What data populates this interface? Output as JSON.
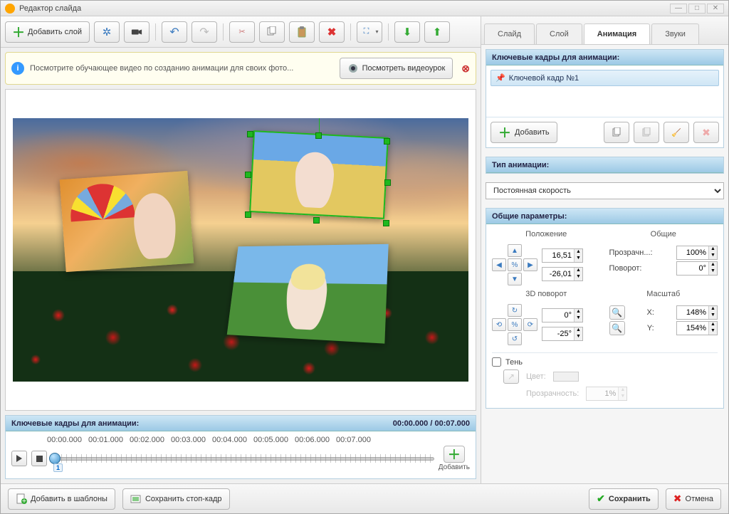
{
  "window": {
    "title": "Редактор слайда"
  },
  "toolbar": {
    "add_layer": "Добавить слой"
  },
  "infobar": {
    "text": "Посмотрите обучающее видео по созданию анимации для своих фото...",
    "watch_btn": "Посмотреть видеоурок"
  },
  "timeline": {
    "header": "Ключевые кадры для анимации:",
    "time_current": "00:00.000",
    "time_total": "00:07.000",
    "ticks": [
      "00:00.000",
      "00:01.000",
      "00:02.000",
      "00:03.000",
      "00:04.000",
      "00:05.000",
      "00:06.000",
      "00:07.000"
    ],
    "add_label": "Добавить",
    "keyframe_number": "1"
  },
  "bottom": {
    "add_template": "Добавить в шаблоны",
    "save_stop": "Сохранить стоп-кадр",
    "save": "Сохранить",
    "cancel": "Отмена"
  },
  "tabs": {
    "slide": "Слайд",
    "layer": "Слой",
    "animation": "Анимация",
    "sounds": "Звуки"
  },
  "right": {
    "kf_header": "Ключевые кадры для анимации:",
    "kf_item": "Ключевой кадр №1",
    "kf_add": "Добавить",
    "anim_type_header": "Тип анимации:",
    "anim_type_value": "Постоянная скорость",
    "params_header": "Общие параметры:",
    "position_label": "Положение",
    "common_label": "Общие",
    "rot3d_label": "3D поворот",
    "scale_label": "Масштаб",
    "pos_x": "16,51",
    "pos_y": "-26,01",
    "opacity_label": "Прозрачн...:",
    "opacity_val": "100%",
    "rotation_label": "Поворот:",
    "rotation_val": "0°",
    "rot3d_x": "0°",
    "rot3d_y": "-25°",
    "scale_x_label": "X:",
    "scale_x_val": "148%",
    "scale_y_label": "Y:",
    "scale_y_val": "154%",
    "shadow_label": "Тень",
    "shadow_color": "Цвет:",
    "shadow_opacity": "Прозрачность:",
    "shadow_opacity_val": "1%"
  }
}
